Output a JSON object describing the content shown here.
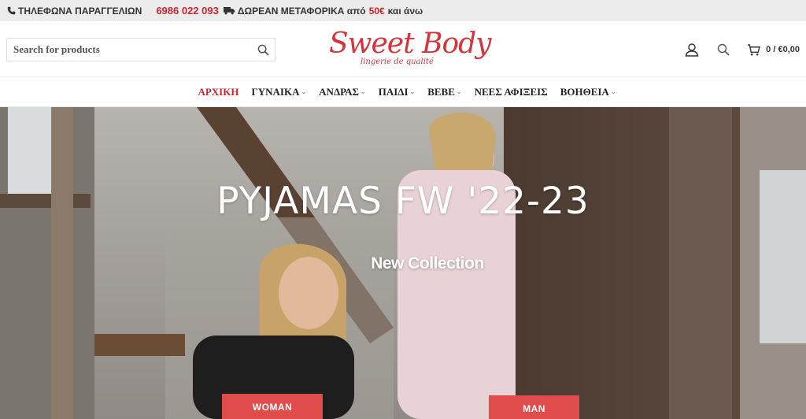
{
  "topbar": {
    "phone_label": "ΤΗΛΕΦΩΝΑ ΠΑΡΑΓΓΕΛΙΩΝ",
    "phone_number": "6986 022 093",
    "shipping_label": "ΔΩΡΕΑΝ ΜΕΤΑΦΟΡΙΚΑ από",
    "shipping_amount": "50€",
    "shipping_suffix": "και άνω"
  },
  "header": {
    "search_placeholder": "Search for products",
    "logo_brand": "Sweet Body",
    "logo_tagline": "lingerie de qualité",
    "cart_total": "0 / €0,00"
  },
  "nav": {
    "items": [
      {
        "label": "ΑΡΧΙΚΗ",
        "active": true,
        "dropdown": false
      },
      {
        "label": "ΓΥΝΑΙΚΑ",
        "active": false,
        "dropdown": true
      },
      {
        "label": "ΑΝΔΡΑΣ",
        "active": false,
        "dropdown": true
      },
      {
        "label": "ΠΑΙΔΙ",
        "active": false,
        "dropdown": true
      },
      {
        "label": "ΒΕΒΕ",
        "active": false,
        "dropdown": true
      },
      {
        "label": "ΝΕΕΣ ΑΦΙΞΕΙΣ",
        "active": false,
        "dropdown": false
      },
      {
        "label": "ΒΟΗΘΕΙΑ",
        "active": false,
        "dropdown": true
      }
    ]
  },
  "hero": {
    "title": "PYJAMAS FW '22-23",
    "subtitle": "New Collection",
    "button_woman": "WOMAN",
    "button_man": "MAN"
  },
  "colors": {
    "accent": "#c8262e",
    "button": "#e04b4b",
    "topbar_bg": "#ececec"
  },
  "icons": [
    "phone-icon",
    "truck-icon",
    "search-icon",
    "user-icon",
    "search-icon",
    "cart-icon"
  ]
}
